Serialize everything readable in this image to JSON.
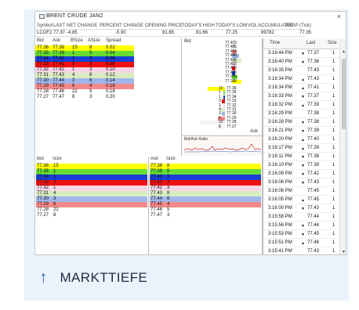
{
  "window": {
    "title": "BRENT CRUDE JAN2",
    "close_glyph": "×"
  },
  "quote": {
    "headers": [
      "Symbol",
      "LAST",
      "NET CHANGE",
      "PERCENT CHANGE",
      "OPENING PRICE",
      "TODAY'S HIGH",
      "TODAY'S LOW",
      "VOL ACCUMULATED",
      "VWAP (Tick)"
    ],
    "values": [
      "LCOF2",
      "77.37",
      "-4.85",
      "-5.90",
      "81.65",
      "81.66",
      "77.25",
      "89782",
      "77.35"
    ]
  },
  "ladder": {
    "headers": [
      "Bid",
      "Ask",
      "BSize",
      "ASize",
      "Spread"
    ],
    "rows": [
      {
        "cells": [
          "77.36",
          "77.38",
          "15",
          "8",
          "0.02"
        ],
        "color": "#ffff00"
      },
      {
        "cells": [
          "77.35",
          "77.39",
          "1",
          "5",
          "0.04"
        ],
        "color": "#66dd33"
      },
      {
        "cells": [
          "77.34",
          "77.40",
          "1",
          "3",
          "0.06"
        ],
        "color": "#1a3fd6"
      },
      {
        "cells": [
          "77.33",
          "77.41",
          "3",
          "3",
          "0.08"
        ],
        "color": "#ee1111"
      },
      {
        "cells": [
          "77.32",
          "77.42",
          "1",
          "3",
          "0.10"
        ],
        "color": "#f7d6e8"
      },
      {
        "cells": [
          "77.31",
          "77.43",
          "4",
          "8",
          "0.12"
        ],
        "color": "#d8ecc2"
      },
      {
        "cells": [
          "77.30",
          "77.44",
          "3",
          "6",
          "0.14"
        ],
        "color": "#9fb6ea"
      },
      {
        "cells": [
          "77.29",
          "77.45",
          "6",
          "4",
          "0.16"
        ],
        "color": "#f48a8a"
      },
      {
        "cells": [
          "77.28",
          "77.46",
          "22",
          "5",
          "0.18"
        ],
        "color": "#ffffff"
      },
      {
        "cells": [
          "77.27",
          "77.47",
          "8",
          "3",
          "0.20"
        ],
        "color": "#ffffff"
      }
    ]
  },
  "depth": {
    "bid_label": "Bid",
    "ask_label": "Ask",
    "ratio_label": "Bid/Ask Ratio",
    "ask_levels": [
      {
        "price": "77.47",
        "size": "3",
        "color": "#ffffff"
      },
      {
        "price": "77.46",
        "size": "5",
        "color": "#ffffff"
      },
      {
        "price": "77.45",
        "size": "4",
        "color": "#f48a8a"
      },
      {
        "price": "77.44",
        "size": "6",
        "color": "#9fb6ea"
      },
      {
        "price": "77.43",
        "size": "8",
        "color": "#d8ecc2"
      },
      {
        "price": "77.42",
        "size": "3",
        "color": "#f7d6e8"
      },
      {
        "price": "77.41",
        "size": "3",
        "color": "#ee1111"
      },
      {
        "price": "77.40",
        "size": "3",
        "color": "#1a3fd6"
      },
      {
        "price": "77.39",
        "size": "5",
        "color": "#66dd33"
      },
      {
        "price": "77.38",
        "size": "8",
        "color": "#ffff00"
      }
    ],
    "bid_levels": [
      {
        "price": "77.36",
        "size": "15",
        "color": "#ffff00"
      },
      {
        "price": "77.35",
        "size": "1",
        "color": "#66dd33"
      },
      {
        "price": "77.34",
        "size": "1",
        "color": "#1a3fd6"
      },
      {
        "price": "77.33",
        "size": "3",
        "color": "#ee1111"
      },
      {
        "price": "77.32",
        "size": "1",
        "color": "#f7d6e8"
      },
      {
        "price": "77.31",
        "size": "4",
        "color": "#d8ecc2"
      },
      {
        "price": "77.30",
        "size": "3",
        "color": "#9fb6ea"
      },
      {
        "price": "77.29",
        "size": "6",
        "color": "#f48a8a"
      },
      {
        "price": "77.28",
        "size": "22",
        "color": "#ffffff"
      },
      {
        "price": "77.27",
        "size": "8",
        "color": "#ffffff"
      }
    ]
  },
  "bid_grid": {
    "headers": [
      "Bid",
      "Size"
    ],
    "rows": [
      {
        "cells": [
          "77.36",
          "15"
        ],
        "color": "#ffff00"
      },
      {
        "cells": [
          "77.35",
          "1"
        ],
        "color": "#66dd33"
      },
      {
        "cells": [
          "77.34",
          "1"
        ],
        "color": "#1a3fd6"
      },
      {
        "cells": [
          "77.33",
          "3"
        ],
        "color": "#ee1111"
      },
      {
        "cells": [
          "77.32",
          "1"
        ],
        "color": "#f7d6e8"
      },
      {
        "cells": [
          "77.31",
          "4"
        ],
        "color": "#d8ecc2"
      },
      {
        "cells": [
          "77.30",
          "3"
        ],
        "color": "#9fb6ea"
      },
      {
        "cells": [
          "77.29",
          "6"
        ],
        "color": "#f48a8a"
      },
      {
        "cells": [
          "77.28",
          "22"
        ],
        "color": "#ffffff"
      },
      {
        "cells": [
          "77.27",
          "8"
        ],
        "color": "#ffffff"
      }
    ]
  },
  "ask_grid": {
    "headers": [
      "Ask",
      "Size"
    ],
    "rows": [
      {
        "cells": [
          "77.38",
          "8"
        ],
        "color": "#ffff00"
      },
      {
        "cells": [
          "77.39",
          "5"
        ],
        "color": "#66dd33"
      },
      {
        "cells": [
          "77.40",
          "3"
        ],
        "color": "#1a3fd6"
      },
      {
        "cells": [
          "77.41",
          "3"
        ],
        "color": "#ee1111"
      },
      {
        "cells": [
          "77.42",
          "3"
        ],
        "color": "#f7d6e8"
      },
      {
        "cells": [
          "77.43",
          "8"
        ],
        "color": "#d8ecc2"
      },
      {
        "cells": [
          "77.44",
          "6"
        ],
        "color": "#9fb6ea"
      },
      {
        "cells": [
          "77.45",
          "4"
        ],
        "color": "#f48a8a"
      },
      {
        "cells": [
          "77.46",
          "5"
        ],
        "color": "#ffffff"
      },
      {
        "cells": [
          "77.47",
          "3"
        ],
        "color": "#ffffff"
      }
    ]
  },
  "time_sales": {
    "headers": [
      "Time",
      "Last",
      "Size"
    ],
    "rows": [
      {
        "time": "3:16:44 PM",
        "dir": "down",
        "last": "77.37",
        "size": "1"
      },
      {
        "time": "3:16:40 PM",
        "dir": "down",
        "last": "77.38",
        "size": "1"
      },
      {
        "time": "3:16:35 PM",
        "dir": "",
        "last": "77.43",
        "size": "1"
      },
      {
        "time": "3:16:34 PM",
        "dir": "up",
        "last": "77.43",
        "size": "1"
      },
      {
        "time": "3:16:34 PM",
        "dir": "up",
        "last": "77.41",
        "size": "1"
      },
      {
        "time": "3:16:33 PM",
        "dir": "down",
        "last": "77.37",
        "size": "1"
      },
      {
        "time": "3:16:32 PM",
        "dir": "up",
        "last": "77.39",
        "size": "1"
      },
      {
        "time": "3:16:29 PM",
        "dir": "",
        "last": "77.38",
        "size": "1"
      },
      {
        "time": "3:16:28 PM",
        "dir": "down",
        "last": "77.38",
        "size": "1"
      },
      {
        "time": "3:16:21 PM",
        "dir": "down",
        "last": "77.39",
        "size": "1"
      },
      {
        "time": "3:16:20 PM",
        "dir": "up",
        "last": "77.40",
        "size": "1"
      },
      {
        "time": "3:16:17 PM",
        "dir": "up",
        "last": "77.39",
        "size": "1"
      },
      {
        "time": "3:16:11 PM",
        "dir": "down",
        "last": "77.38",
        "size": "1"
      },
      {
        "time": "3:16:10 PM",
        "dir": "down",
        "last": "77.39",
        "size": "1"
      },
      {
        "time": "3:16:09 PM",
        "dir": "down",
        "last": "77.42",
        "size": "1"
      },
      {
        "time": "3:16:06 PM",
        "dir": "down",
        "last": "77.43",
        "size": "1"
      },
      {
        "time": "3:16:06 PM",
        "dir": "",
        "last": "77.45",
        "size": "1"
      },
      {
        "time": "3:16:05 PM",
        "dir": "up",
        "last": "77.45",
        "size": "1"
      },
      {
        "time": "3:16:00 PM",
        "dir": "down",
        "last": "77.43",
        "size": "1"
      },
      {
        "time": "3:15:58 PM",
        "dir": "",
        "last": "77.44",
        "size": "1"
      },
      {
        "time": "3:15:56 PM",
        "dir": "down",
        "last": "77.44",
        "size": "1"
      },
      {
        "time": "3:15:53 PM",
        "dir": "down",
        "last": "77.45",
        "size": "1"
      },
      {
        "time": "3:15:51 PM",
        "dir": "up",
        "last": "77.46",
        "size": "1"
      },
      {
        "time": "3:15:41 PM",
        "dir": "",
        "last": "77.43",
        "size": "1"
      }
    ]
  },
  "footer": {
    "arrow": "↑",
    "label": "MARKTTIEFE",
    "accent": "#2266aa"
  }
}
